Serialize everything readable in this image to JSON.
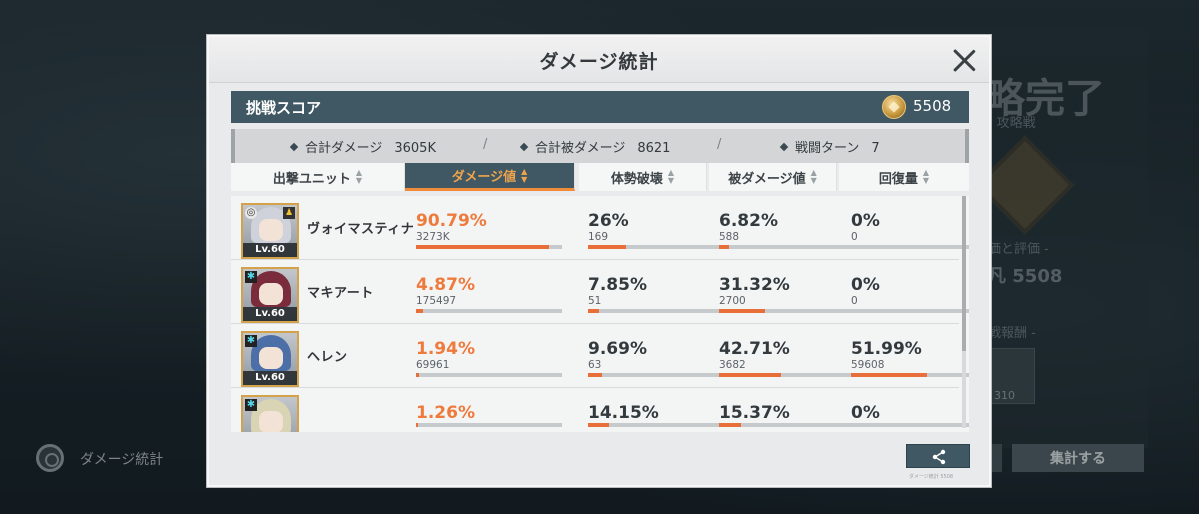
{
  "background": {
    "left_label": "ダメージ統計",
    "right_title": "略完了",
    "right_sub": "F 攻略戦",
    "right_sub2": "価と評価 -",
    "right_score": "凡 5508",
    "right_sub3": "戦報酬 -",
    "right_item_count": "310",
    "right_button": "集計する"
  },
  "dialog": {
    "title": "ダメージ統計",
    "score": {
      "label": "挑戦スコア",
      "value": "5508"
    },
    "summary": [
      {
        "label": "合計ダメージ",
        "value": "3605K"
      },
      {
        "label": "合計被ダメージ",
        "value": "8621"
      },
      {
        "label": "戦闘ターン",
        "value": "7"
      }
    ],
    "separator": "/",
    "tabs": [
      {
        "label": "出撃ユニット",
        "active": false
      },
      {
        "label": "ダメージ値",
        "active": true
      },
      {
        "label": "体勢破壊",
        "active": false
      },
      {
        "label": "被ダメージ値",
        "active": false
      },
      {
        "label": "回復量",
        "active": false
      }
    ],
    "rows": [
      {
        "name": "ヴォイマスティナ",
        "level": "Lv.60",
        "hair": "#cfd2da",
        "type": "light",
        "damage": {
          "pct": "90.79%",
          "num": "3273K",
          "fill": 0.9079
        },
        "break": {
          "pct": "26%",
          "num": "169",
          "fill": 0.26
        },
        "taken": {
          "pct": "6.82%",
          "num": "588",
          "fill": 0.0682
        },
        "heal": {
          "pct": "0%",
          "num": "0",
          "fill": 0
        }
      },
      {
        "name": "マキアート",
        "level": "Lv.60",
        "hair": "#7a2b3c",
        "type": "ice",
        "damage": {
          "pct": "4.87%",
          "num": "175497",
          "fill": 0.0487
        },
        "break": {
          "pct": "7.85%",
          "num": "51",
          "fill": 0.0785
        },
        "taken": {
          "pct": "31.32%",
          "num": "2700",
          "fill": 0.3132
        },
        "heal": {
          "pct": "0%",
          "num": "0",
          "fill": 0
        }
      },
      {
        "name": "ヘレン",
        "level": "Lv.60",
        "hair": "#4c6fa8",
        "type": "ice",
        "damage": {
          "pct": "1.94%",
          "num": "69961",
          "fill": 0.0194
        },
        "break": {
          "pct": "9.69%",
          "num": "63",
          "fill": 0.0969
        },
        "taken": {
          "pct": "42.71%",
          "num": "3682",
          "fill": 0.4271
        },
        "heal": {
          "pct": "51.99%",
          "num": "59608",
          "fill": 0.5199
        }
      },
      {
        "name": "",
        "level": "",
        "hair": "#d9d4b4",
        "type": "ice",
        "damage": {
          "pct": "1.26%",
          "num": "",
          "fill": 0.0126
        },
        "break": {
          "pct": "14.15%",
          "num": "",
          "fill": 0.1415
        },
        "taken": {
          "pct": "15.37%",
          "num": "",
          "fill": 0.1537
        },
        "heal": {
          "pct": "0%",
          "num": "",
          "fill": 0
        }
      }
    ],
    "footnote": "ダメージ統計 5508"
  },
  "colors": {
    "accent": "#ee7a3c",
    "bar_fill": "#e86e3a",
    "header_dark": "#3f5864",
    "tab_active_text": "#f0a44a"
  }
}
